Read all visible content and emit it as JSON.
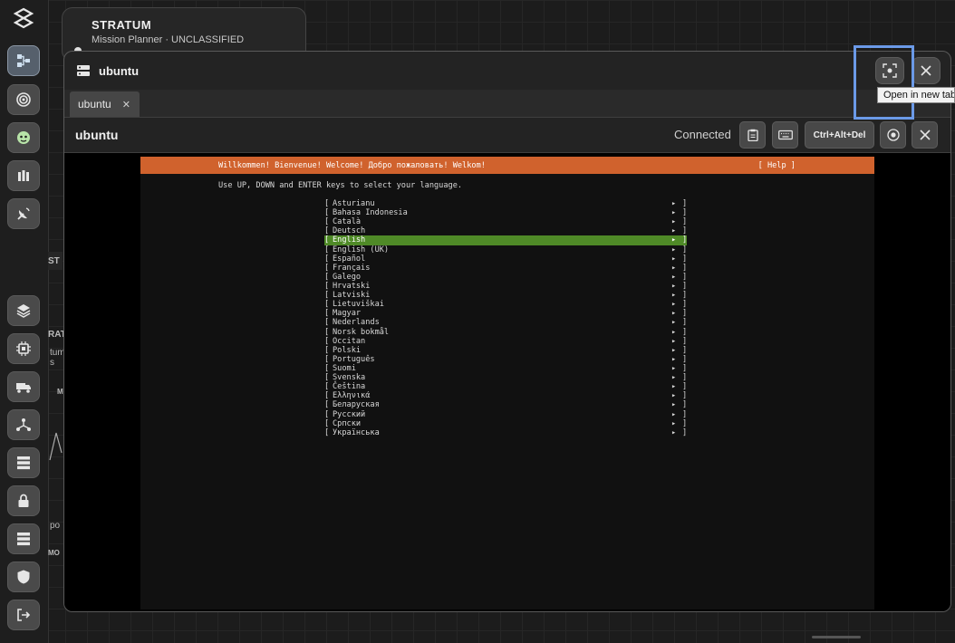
{
  "background": {
    "card_title": "STRATUM",
    "card_subtitle": "Mission Planner · UNCLASSIFIED",
    "fragment_st": "ST",
    "fragment_rat": "RAT",
    "fragment_tum": "tum",
    "fragment_s": "s",
    "fragment_m": "M",
    "fragment_po": "po",
    "fragment_mo": "MO"
  },
  "window": {
    "title": "ubuntu",
    "tab_label": "ubuntu",
    "tooltip": "Open in new tab"
  },
  "toolbar": {
    "title": "ubuntu",
    "status": "Connected",
    "ctrl_alt_del_label": "Ctrl+Alt+Del"
  },
  "terminal": {
    "banner": "Willkommen! Bienvenue! Welcome! Добро пожаловать! Welkom!",
    "help": "[ Help ]",
    "instructions": "Use UP, DOWN and ENTER keys to select your language.",
    "selected_language": "English",
    "languages": [
      "Asturianu",
      "Bahasa Indonesia",
      "Català",
      "Deutsch",
      "English",
      "English (UK)",
      "Español",
      "Français",
      "Galego",
      "Hrvatski",
      "Latviski",
      "Lietuviškai",
      "Magyar",
      "Nederlands",
      "Norsk bokmål",
      "Occitan",
      "Polski",
      "Português",
      "Suomi",
      "Svenska",
      "Čeština",
      "Ελληνικά",
      "Беларуская",
      "Русский",
      "Српски",
      "Українська"
    ]
  },
  "colors": {
    "banner": "#d0622d",
    "selection": "#4f8a27",
    "highlight": "#6b9ae8"
  }
}
